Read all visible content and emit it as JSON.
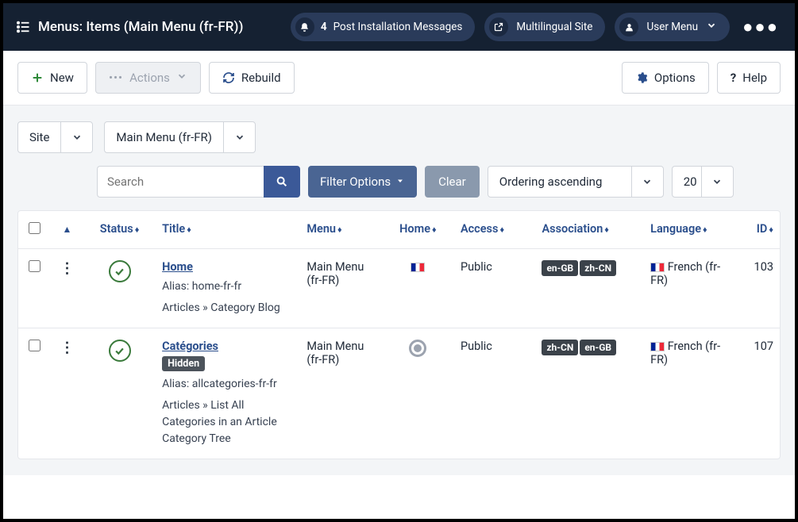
{
  "topbar": {
    "title": "Menus: Items (Main Menu (fr-FR))",
    "notifications": {
      "count": "4",
      "label": "Post Installation Messages"
    },
    "siteLink": "Multilingual Site",
    "userMenu": "User Menu"
  },
  "toolbar": {
    "new": "New",
    "actions": "Actions",
    "rebuild": "Rebuild",
    "options": "Options",
    "help": "Help"
  },
  "filters": {
    "client": "Site",
    "menuType": "Main Menu (fr-FR)",
    "searchPlaceholder": "Search",
    "filterOptions": "Filter Options",
    "clear": "Clear",
    "ordering": "Ordering ascending",
    "limit": "20"
  },
  "columns": {
    "status": "Status",
    "title": "Title",
    "menu": "Menu",
    "home": "Home",
    "access": "Access",
    "association": "Association",
    "language": "Language",
    "id": "ID"
  },
  "rows": [
    {
      "title": "Home",
      "hidden": false,
      "alias": "Alias: home-fr-fr",
      "path": "Articles » Category Blog",
      "menu": "Main Menu (fr-FR)",
      "homeFlag": true,
      "access": "Public",
      "assoc": [
        "en-GB",
        "zh-CN"
      ],
      "language": "French (fr-FR)",
      "id": "103"
    },
    {
      "title": "Catégories",
      "hidden": true,
      "hiddenLabel": "Hidden",
      "alias": "Alias: allcategories-fr-fr",
      "path": "Articles » List All Categories in an Article Category Tree",
      "menu": "Main Menu (fr-FR)",
      "homeFlag": false,
      "access": "Public",
      "assoc": [
        "zh-CN",
        "en-GB"
      ],
      "language": "French (fr-FR)",
      "id": "107"
    }
  ]
}
